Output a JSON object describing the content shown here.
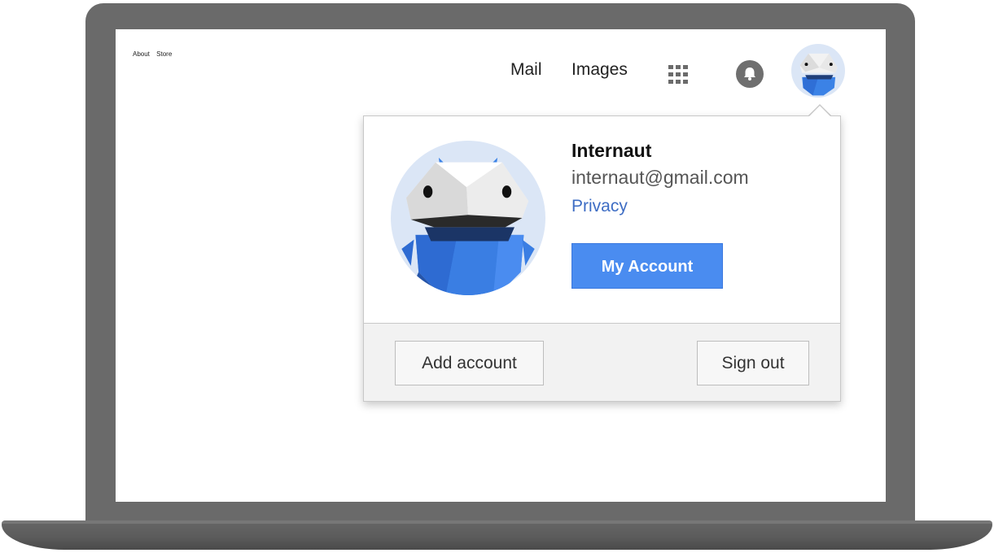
{
  "top_links": [
    "About",
    "Store"
  ],
  "header": {
    "mail_label": "Mail",
    "images_label": "Images",
    "apps_icon": "apps-grid-icon",
    "notifications_icon": "bell-icon"
  },
  "account_card": {
    "name": "Internaut",
    "email": "internaut@gmail.com",
    "privacy_label": "Privacy",
    "my_account_label": "My Account",
    "add_account_label": "Add account",
    "sign_out_label": "Sign out"
  },
  "colors": {
    "primary_button": "#4a8cf0",
    "link": "#3e6dc4",
    "laptop_frame": "#6a6a6a",
    "avatar_background": "#dbe6f6",
    "robot_blue": "#3b82e6"
  }
}
